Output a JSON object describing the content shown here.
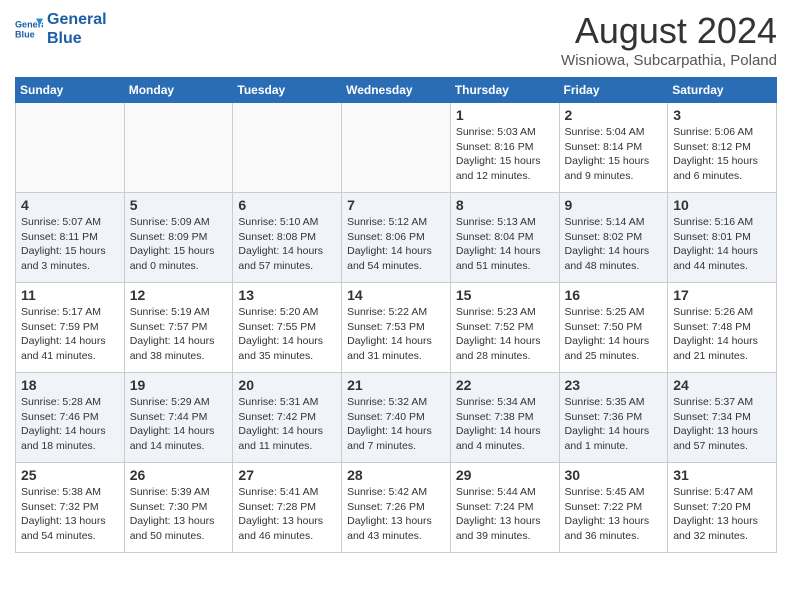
{
  "header": {
    "logo_line1": "General",
    "logo_line2": "Blue",
    "month_year": "August 2024",
    "location": "Wisniowa, Subcarpathia, Poland"
  },
  "weekdays": [
    "Sunday",
    "Monday",
    "Tuesday",
    "Wednesday",
    "Thursday",
    "Friday",
    "Saturday"
  ],
  "weeks": [
    [
      {
        "day": "",
        "info": "",
        "empty": true
      },
      {
        "day": "",
        "info": "",
        "empty": true
      },
      {
        "day": "",
        "info": "",
        "empty": true
      },
      {
        "day": "",
        "info": "",
        "empty": true
      },
      {
        "day": "1",
        "info": "Sunrise: 5:03 AM\nSunset: 8:16 PM\nDaylight: 15 hours\nand 12 minutes."
      },
      {
        "day": "2",
        "info": "Sunrise: 5:04 AM\nSunset: 8:14 PM\nDaylight: 15 hours\nand 9 minutes."
      },
      {
        "day": "3",
        "info": "Sunrise: 5:06 AM\nSunset: 8:12 PM\nDaylight: 15 hours\nand 6 minutes."
      }
    ],
    [
      {
        "day": "4",
        "info": "Sunrise: 5:07 AM\nSunset: 8:11 PM\nDaylight: 15 hours\nand 3 minutes."
      },
      {
        "day": "5",
        "info": "Sunrise: 5:09 AM\nSunset: 8:09 PM\nDaylight: 15 hours\nand 0 minutes."
      },
      {
        "day": "6",
        "info": "Sunrise: 5:10 AM\nSunset: 8:08 PM\nDaylight: 14 hours\nand 57 minutes."
      },
      {
        "day": "7",
        "info": "Sunrise: 5:12 AM\nSunset: 8:06 PM\nDaylight: 14 hours\nand 54 minutes."
      },
      {
        "day": "8",
        "info": "Sunrise: 5:13 AM\nSunset: 8:04 PM\nDaylight: 14 hours\nand 51 minutes."
      },
      {
        "day": "9",
        "info": "Sunrise: 5:14 AM\nSunset: 8:02 PM\nDaylight: 14 hours\nand 48 minutes."
      },
      {
        "day": "10",
        "info": "Sunrise: 5:16 AM\nSunset: 8:01 PM\nDaylight: 14 hours\nand 44 minutes."
      }
    ],
    [
      {
        "day": "11",
        "info": "Sunrise: 5:17 AM\nSunset: 7:59 PM\nDaylight: 14 hours\nand 41 minutes."
      },
      {
        "day": "12",
        "info": "Sunrise: 5:19 AM\nSunset: 7:57 PM\nDaylight: 14 hours\nand 38 minutes."
      },
      {
        "day": "13",
        "info": "Sunrise: 5:20 AM\nSunset: 7:55 PM\nDaylight: 14 hours\nand 35 minutes."
      },
      {
        "day": "14",
        "info": "Sunrise: 5:22 AM\nSunset: 7:53 PM\nDaylight: 14 hours\nand 31 minutes."
      },
      {
        "day": "15",
        "info": "Sunrise: 5:23 AM\nSunset: 7:52 PM\nDaylight: 14 hours\nand 28 minutes."
      },
      {
        "day": "16",
        "info": "Sunrise: 5:25 AM\nSunset: 7:50 PM\nDaylight: 14 hours\nand 25 minutes."
      },
      {
        "day": "17",
        "info": "Sunrise: 5:26 AM\nSunset: 7:48 PM\nDaylight: 14 hours\nand 21 minutes."
      }
    ],
    [
      {
        "day": "18",
        "info": "Sunrise: 5:28 AM\nSunset: 7:46 PM\nDaylight: 14 hours\nand 18 minutes."
      },
      {
        "day": "19",
        "info": "Sunrise: 5:29 AM\nSunset: 7:44 PM\nDaylight: 14 hours\nand 14 minutes."
      },
      {
        "day": "20",
        "info": "Sunrise: 5:31 AM\nSunset: 7:42 PM\nDaylight: 14 hours\nand 11 minutes."
      },
      {
        "day": "21",
        "info": "Sunrise: 5:32 AM\nSunset: 7:40 PM\nDaylight: 14 hours\nand 7 minutes."
      },
      {
        "day": "22",
        "info": "Sunrise: 5:34 AM\nSunset: 7:38 PM\nDaylight: 14 hours\nand 4 minutes."
      },
      {
        "day": "23",
        "info": "Sunrise: 5:35 AM\nSunset: 7:36 PM\nDaylight: 14 hours\nand 1 minute."
      },
      {
        "day": "24",
        "info": "Sunrise: 5:37 AM\nSunset: 7:34 PM\nDaylight: 13 hours\nand 57 minutes."
      }
    ],
    [
      {
        "day": "25",
        "info": "Sunrise: 5:38 AM\nSunset: 7:32 PM\nDaylight: 13 hours\nand 54 minutes."
      },
      {
        "day": "26",
        "info": "Sunrise: 5:39 AM\nSunset: 7:30 PM\nDaylight: 13 hours\nand 50 minutes."
      },
      {
        "day": "27",
        "info": "Sunrise: 5:41 AM\nSunset: 7:28 PM\nDaylight: 13 hours\nand 46 minutes."
      },
      {
        "day": "28",
        "info": "Sunrise: 5:42 AM\nSunset: 7:26 PM\nDaylight: 13 hours\nand 43 minutes."
      },
      {
        "day": "29",
        "info": "Sunrise: 5:44 AM\nSunset: 7:24 PM\nDaylight: 13 hours\nand 39 minutes."
      },
      {
        "day": "30",
        "info": "Sunrise: 5:45 AM\nSunset: 7:22 PM\nDaylight: 13 hours\nand 36 minutes."
      },
      {
        "day": "31",
        "info": "Sunrise: 5:47 AM\nSunset: 7:20 PM\nDaylight: 13 hours\nand 32 minutes."
      }
    ]
  ]
}
